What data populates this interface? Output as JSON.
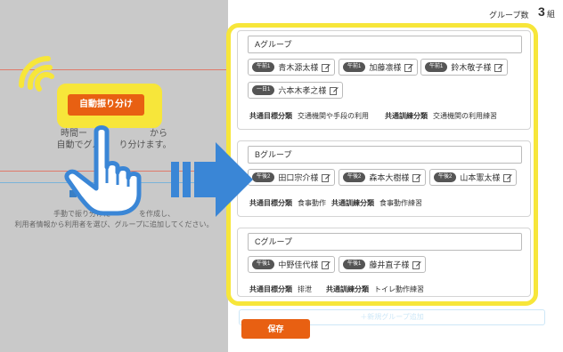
{
  "left": {
    "auto_button": "自動振り分け",
    "desc_line1": "時間ー　　　　　　　から",
    "desc_line2": "自動でグル　　り分けます。",
    "manual_line1": "手動で振り分けた　　　　を作成し、",
    "manual_line2": "利用者情報から利用者を選び、グループに追加してください。"
  },
  "header": {
    "group_count_label": "グループ数",
    "group_count_value": "3",
    "group_count_unit": "組"
  },
  "groups": [
    {
      "name": "Aグループ",
      "members": [
        {
          "badge": "午前1",
          "name": "青木源太様"
        },
        {
          "badge": "午前1",
          "name": "加藤凛様"
        },
        {
          "badge": "午前1",
          "name": "鈴木敬子様"
        },
        {
          "badge": "一日1",
          "name": "六本木孝之様"
        }
      ],
      "goal_label": "共通目標分類",
      "goal_value": "交通機関や手段の利用",
      "training_label": "共通訓練分類",
      "training_value": "交通機関の利用練習"
    },
    {
      "name": "Bグループ",
      "members": [
        {
          "badge": "午後2",
          "name": "田口宗介様"
        },
        {
          "badge": "午後2",
          "name": "森本大樹様"
        },
        {
          "badge": "午後2",
          "name": "山本憲太様"
        }
      ],
      "goal_label": "共通目標分類",
      "goal_value": "食事動作",
      "training_label": "共通訓練分類",
      "training_value": "食事動作練習"
    },
    {
      "name": "Cグループ",
      "members": [
        {
          "badge": "午後1",
          "name": "中野佳代様"
        },
        {
          "badge": "午後1",
          "name": "藤井直子様"
        }
      ],
      "goal_label": "共通目標分類",
      "goal_value": "排泄",
      "training_label": "共通訓練分類",
      "training_value": "トイレ動作練習"
    }
  ],
  "footer": {
    "add_group": "＋新規グループ追加",
    "save_button": "保存"
  },
  "colors": {
    "accent_orange": "#e86012",
    "highlight_yellow": "#f7e63a",
    "arrow_blue": "#3a86d6",
    "overlay_gray": "#c9c9c9"
  },
  "icons": {
    "hand": "pointing-hand-icon",
    "signal": "tap-signal-icon",
    "arrow": "right-arrow-icon",
    "edit": "edit-icon"
  }
}
